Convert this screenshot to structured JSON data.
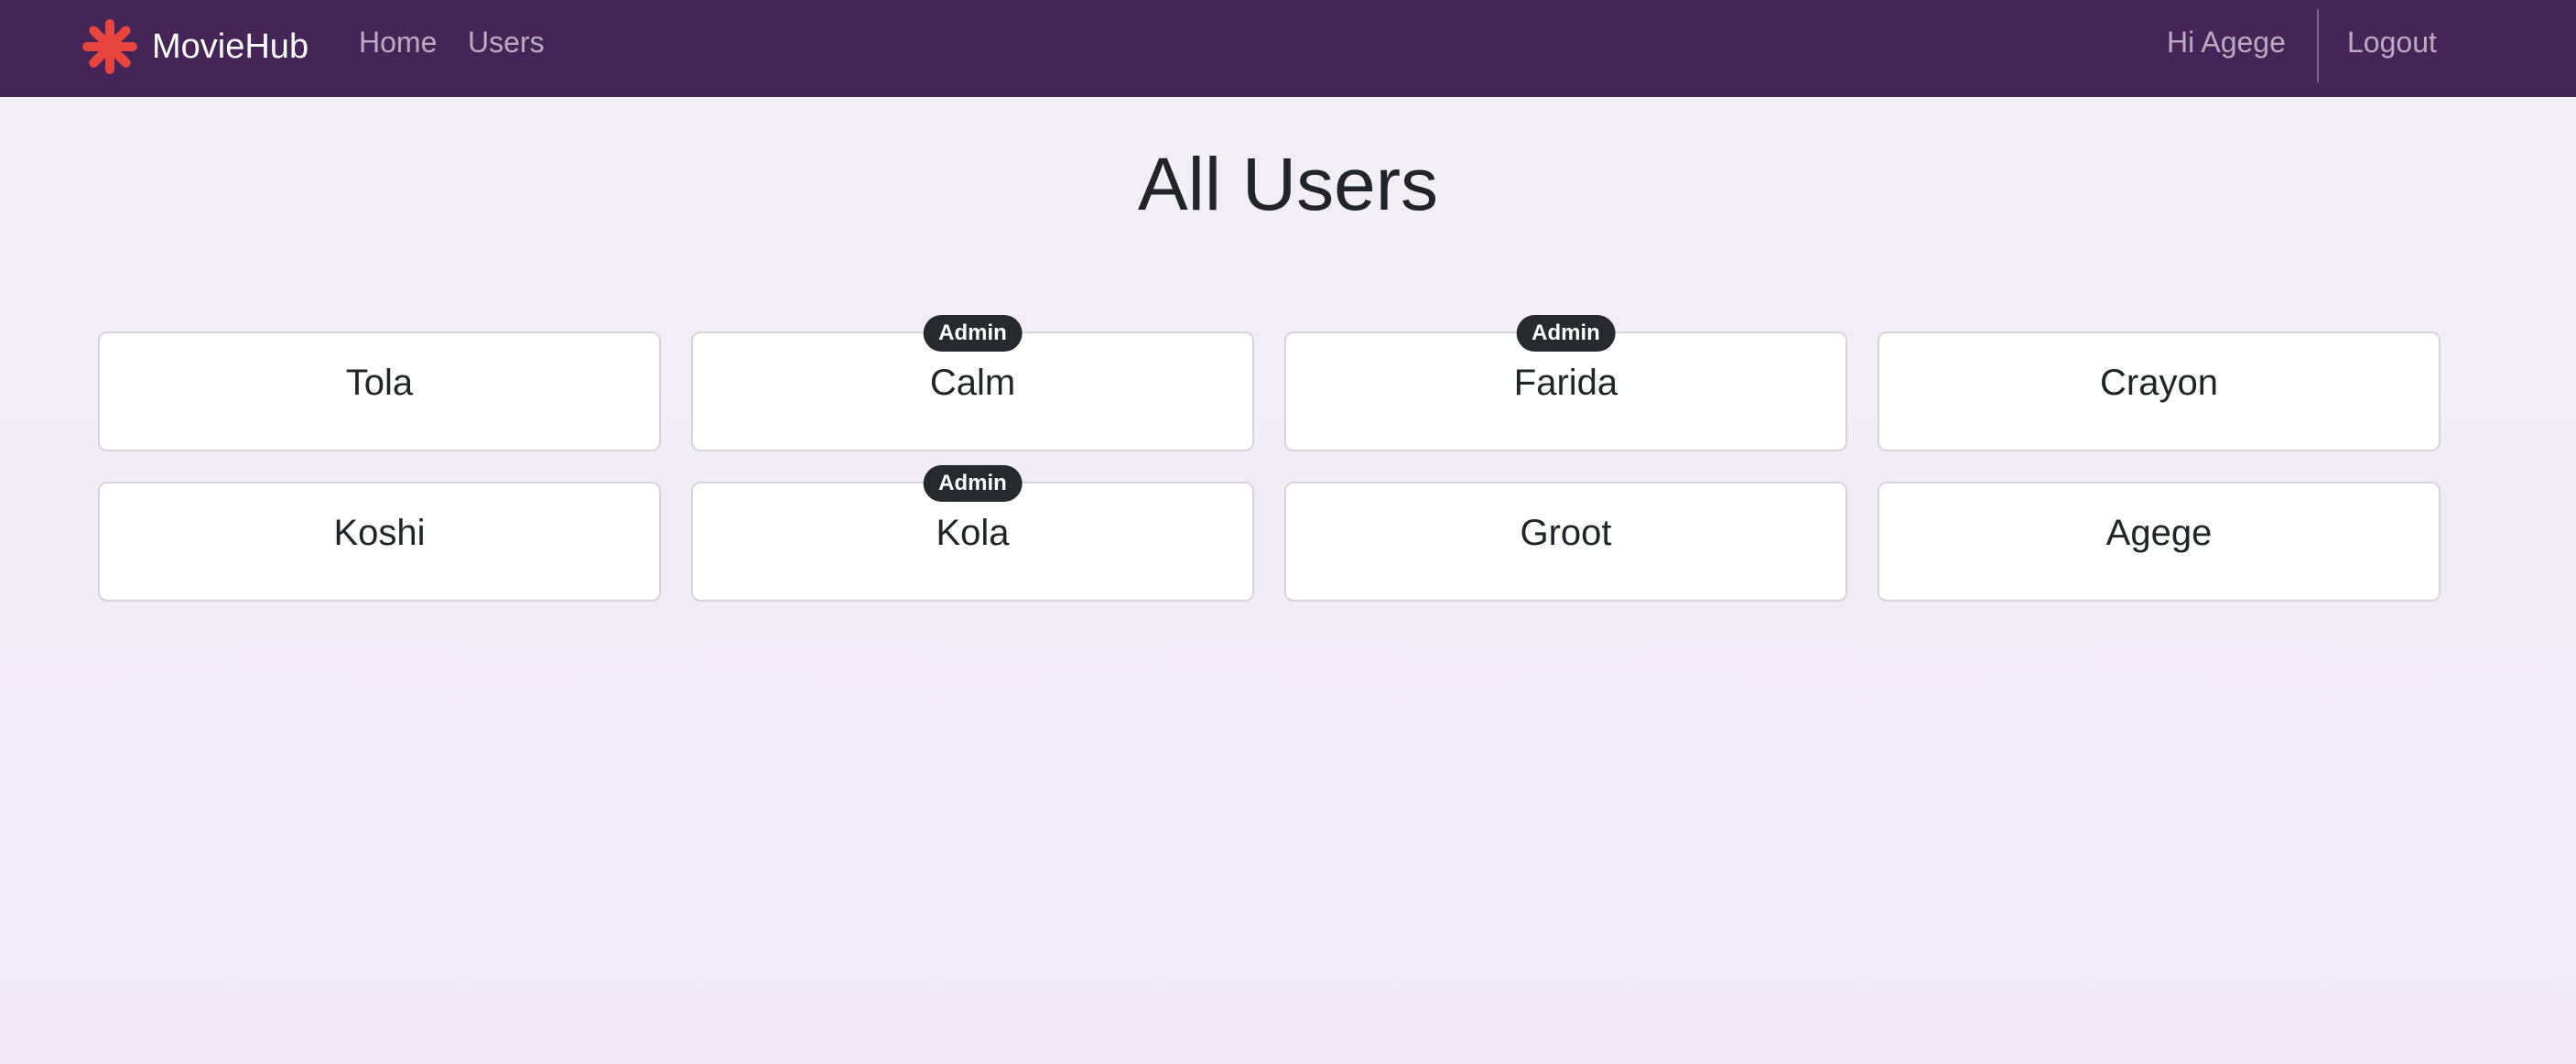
{
  "brand": {
    "name": "MovieHub",
    "logo_icon": "asterisk-logo-icon",
    "logo_color": "#e8453f"
  },
  "nav": {
    "links": [
      {
        "label": "Home"
      },
      {
        "label": "Users"
      }
    ],
    "greeting": "Hi Agege",
    "logout_label": "Logout"
  },
  "page": {
    "title": "All Users"
  },
  "users": [
    {
      "name": "Tola",
      "badge": ""
    },
    {
      "name": "Calm",
      "badge": "Admin"
    },
    {
      "name": "Farida",
      "badge": "Admin"
    },
    {
      "name": "Crayon",
      "badge": ""
    },
    {
      "name": "Koshi",
      "badge": ""
    },
    {
      "name": "Kola",
      "badge": "Admin"
    },
    {
      "name": "Groot",
      "badge": ""
    },
    {
      "name": "Agege",
      "badge": ""
    }
  ],
  "colors": {
    "navbar": "#452457",
    "badge": "#262a2f",
    "page_background": "#f2eff5"
  }
}
